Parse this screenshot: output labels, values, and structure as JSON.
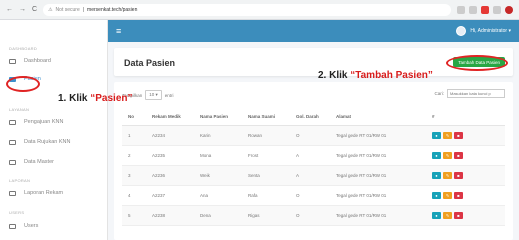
{
  "browser": {
    "nav_back": "←",
    "nav_forward": "→",
    "nav_reload": "C",
    "security": "Not secure",
    "url": "mersenkat.tech/pasien"
  },
  "sidebar": {
    "section_dashboard": "DASHBOARD",
    "section_layanan": "LAYANAN",
    "section_laporan": "LAPORAN",
    "section_users": "USERS",
    "items": [
      {
        "label": "Dashboard"
      },
      {
        "label": "Pasien"
      },
      {
        "label": "Pengajuan KNN"
      },
      {
        "label": "Data Rujukan KNN"
      },
      {
        "label": "Data Master"
      },
      {
        "label": "Laporan Rekam"
      },
      {
        "label": "Users"
      }
    ]
  },
  "topbar": {
    "menu_icon": "≡",
    "user_name": "Hi, Administrator ▾"
  },
  "page": {
    "title": "Data Pasien",
    "add_button": "Tambah Data Pasien"
  },
  "annotations": {
    "step1_prefix": "1. Klik ",
    "step1_target": "“Pasien”",
    "step2_prefix": "2. Klik ",
    "step2_target": "“Tambah Pasien”"
  },
  "table": {
    "show_label": "Tampilkan",
    "show_value": "10 ▾",
    "entries_label": "entri",
    "search_label": "Cari:",
    "search_placeholder": "Masukkan kata kunci p",
    "headers": [
      "No",
      "Rekam Medik",
      "Nama Pasien",
      "Nama Suami",
      "Gol. Darah",
      "Alamat",
      "#"
    ],
    "rows": [
      [
        "1",
        "A2234",
        "Karin",
        "Rowan",
        "O",
        "Tegal gede RT 01/RW 01"
      ],
      [
        "2",
        "A2235",
        "Mona",
        "Frost",
        "A",
        "Tegal gede RT 01/RW 01"
      ],
      [
        "3",
        "A2236",
        "Weik",
        "Senta",
        "A",
        "Tegal gede RT 01/RW 01"
      ],
      [
        "4",
        "A2237",
        "Ana",
        "Rafa",
        "O",
        "Tegal gede RT 01/RW 01"
      ],
      [
        "5",
        "A2238",
        "Dena",
        "Rigas",
        "O",
        "Tegal gede RT 01/RW 01"
      ]
    ]
  },
  "colors": {
    "primary": "#3c8dbc",
    "success": "#28a745",
    "annotation_red": "#d81b1b"
  }
}
